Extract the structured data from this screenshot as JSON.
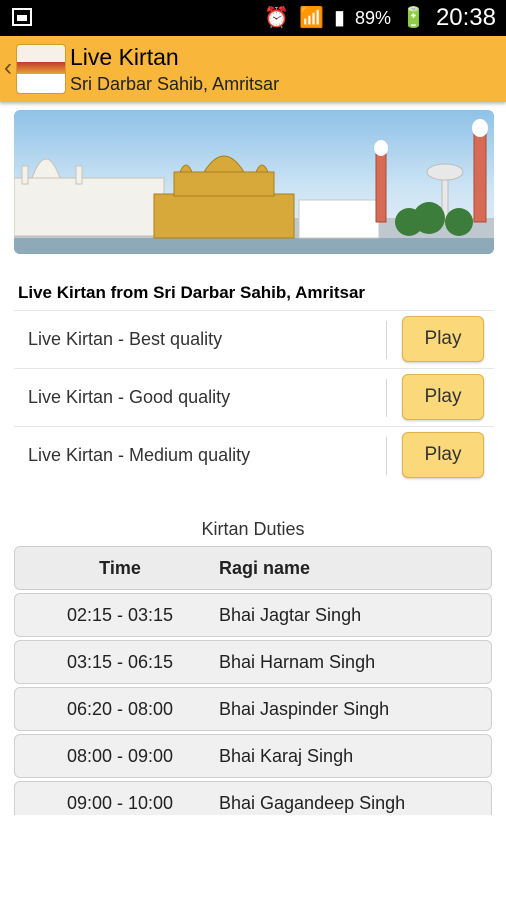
{
  "status_bar": {
    "battery_percent": "89%",
    "time": "20:38",
    "icons": [
      "image-icon",
      "alarm-icon",
      "wifi-icon",
      "signal-icon",
      "battery-icon"
    ]
  },
  "app_bar": {
    "title": "Live Kirtan",
    "subtitle": "Sri Darbar Sahib, Amritsar"
  },
  "section": {
    "title": "Live Kirtan from Sri Darbar Sahib, Amritsar"
  },
  "streams": [
    {
      "label": "Live Kirtan - Best quality",
      "button": "Play"
    },
    {
      "label": "Live Kirtan - Good quality",
      "button": "Play"
    },
    {
      "label": "Live Kirtan - Medium quality",
      "button": "Play"
    }
  ],
  "duties": {
    "title": "Kirtan Duties",
    "headers": [
      "Time",
      "Ragi name"
    ],
    "rows": [
      [
        "02:15 - 03:15",
        "Bhai Jagtar Singh"
      ],
      [
        "03:15 - 06:15",
        "Bhai Harnam Singh"
      ],
      [
        "06:20 - 08:00",
        "Bhai Jaspinder Singh"
      ],
      [
        "08:00 - 09:00",
        "Bhai Karaj Singh"
      ],
      [
        "09:00 - 10:00",
        "Bhai Gagandeep Singh"
      ]
    ]
  },
  "colors": {
    "app_bar": "#f8b63a",
    "play_button": "#fbd87a",
    "table_row": "#f0f0f0"
  }
}
